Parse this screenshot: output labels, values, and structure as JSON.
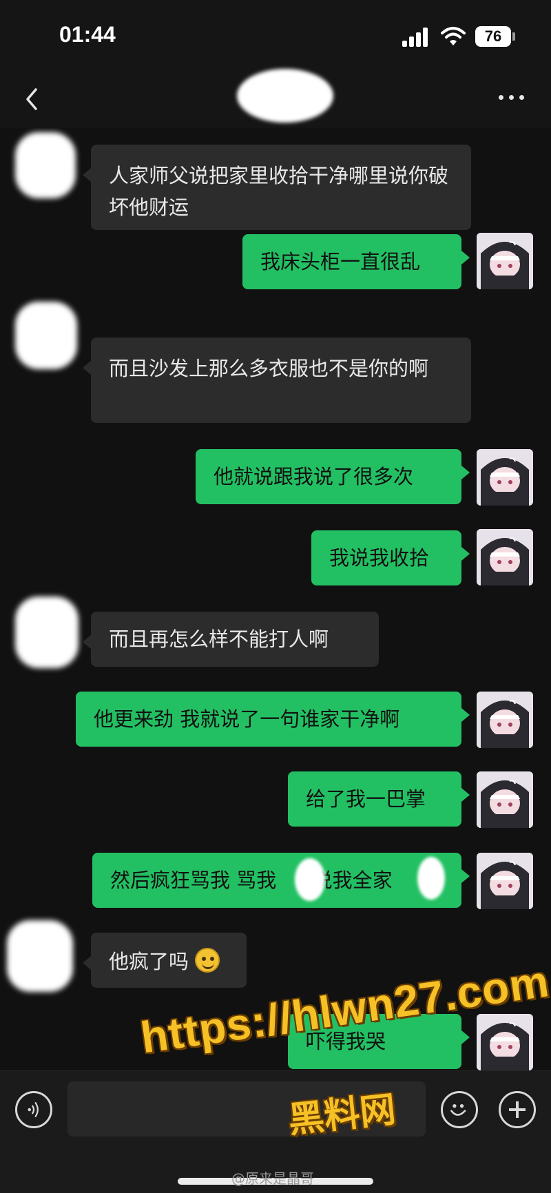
{
  "status_bar": {
    "time": "01:44",
    "battery": "76",
    "icons": [
      "signal-icon",
      "wifi-icon",
      "battery-icon"
    ]
  },
  "nav": {
    "back_icon": "chevron-left-icon",
    "more_icon": "more-icon"
  },
  "messages": [
    {
      "side": "in",
      "text": "人家师父说把家里收拾干净哪里说你破坏他财运"
    },
    {
      "side": "out",
      "text": "我床头柜一直很乱"
    },
    {
      "side": "in",
      "text": "而且沙发上那么多衣服也不是你的啊"
    },
    {
      "side": "out",
      "text": "他就说跟我说了很多次"
    },
    {
      "side": "out",
      "text": "我说我收拾"
    },
    {
      "side": "in",
      "text": "而且再怎么样不能打人啊"
    },
    {
      "side": "out",
      "text": "他更来劲 我就说了一句谁家干净啊"
    },
    {
      "side": "out",
      "text": "给了我一巴掌"
    },
    {
      "side": "out",
      "text_a": "然后疯狂骂我 骂我",
      "text_b": "说我全家"
    },
    {
      "side": "in",
      "text": "他疯了吗",
      "emoji": "smiling-face-emoji"
    },
    {
      "side": "out",
      "text": "吓得我哭"
    }
  ],
  "input_bar": {
    "voice_icon": "voice-icon",
    "emoji_icon": "emoji-icon",
    "plus_icon": "plus-icon"
  },
  "watermark": {
    "url": "https://hlwn27.com",
    "label": "黑料网"
  },
  "credit": "@原来是晶哥"
}
